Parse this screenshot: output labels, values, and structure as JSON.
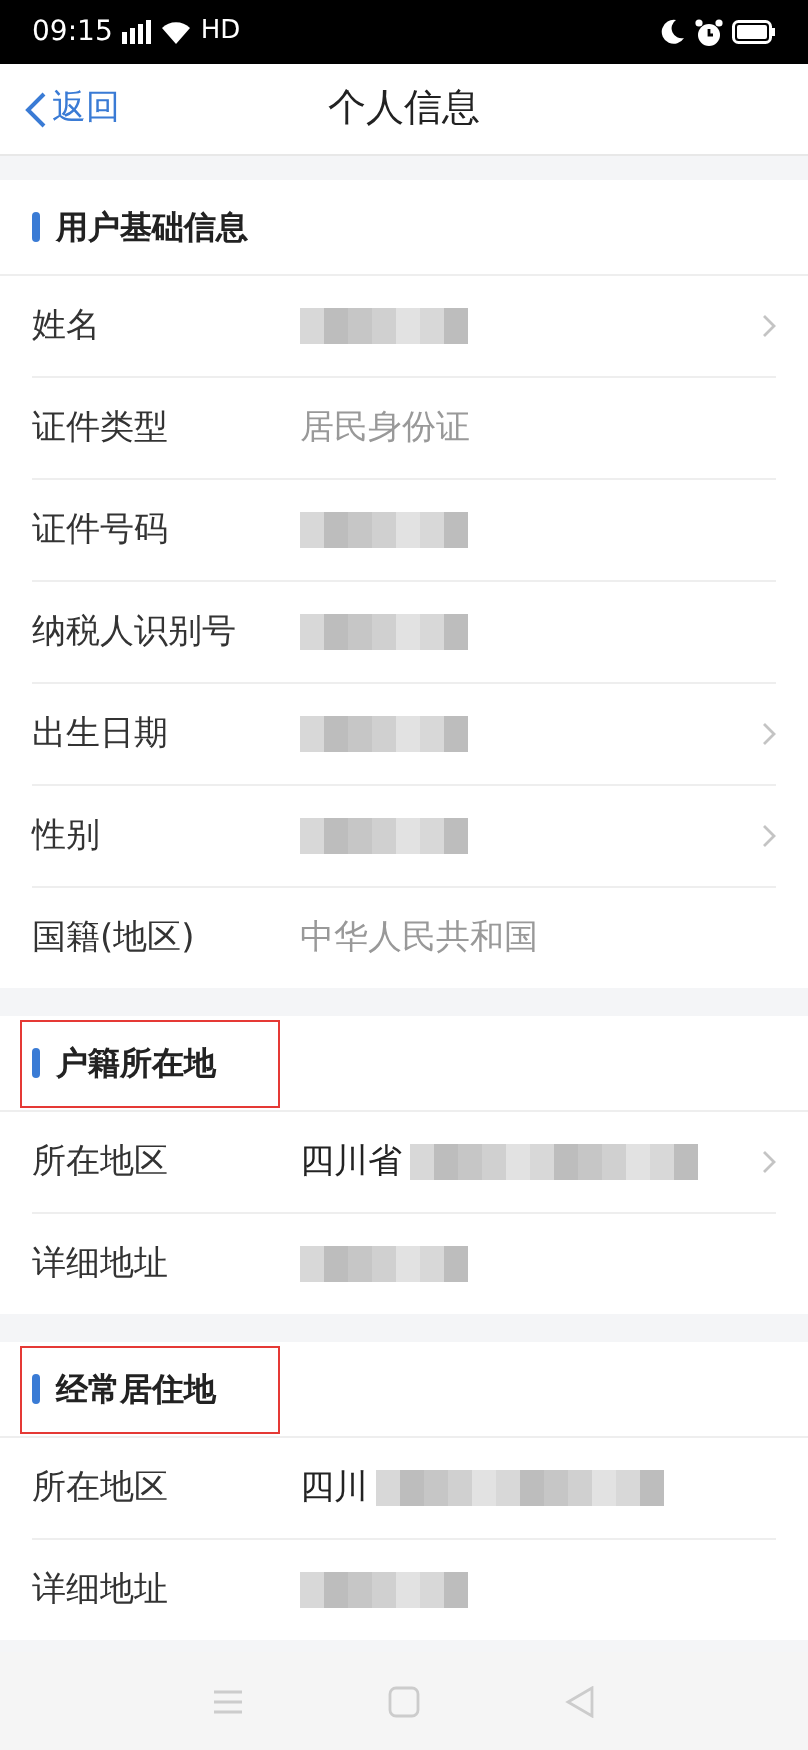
{
  "status_bar": {
    "time": "09:15",
    "network": "HD"
  },
  "header": {
    "back": "返回",
    "title": "个人信息"
  },
  "sections": [
    {
      "title": "用户基础信息",
      "highlighted": false,
      "rows": [
        {
          "label": "姓名",
          "kind": "redacted",
          "chevron": true
        },
        {
          "label": "证件类型",
          "kind": "text",
          "value": "居民身份证",
          "chevron": false
        },
        {
          "label": "证件号码",
          "kind": "redacted",
          "chevron": false
        },
        {
          "label": "纳税人识别号",
          "kind": "redacted",
          "chevron": false
        },
        {
          "label": "出生日期",
          "kind": "redacted",
          "chevron": true
        },
        {
          "label": "性别",
          "kind": "redacted",
          "chevron": true
        },
        {
          "label": "国籍(地区)",
          "kind": "text",
          "value": "中华人民共和国",
          "chevron": false
        }
      ]
    },
    {
      "title": "户籍所在地",
      "highlighted": true,
      "rows": [
        {
          "label": "所在地区",
          "kind": "partial",
          "value": "四川省",
          "chevron": true
        },
        {
          "label": "详细地址",
          "kind": "redacted",
          "chevron": false
        }
      ]
    },
    {
      "title": "经常居住地",
      "highlighted": true,
      "rows": [
        {
          "label": "所在地区",
          "kind": "partial",
          "value": "四川",
          "chevron": false
        },
        {
          "label": "详细地址",
          "kind": "redacted",
          "chevron": false
        }
      ]
    }
  ]
}
